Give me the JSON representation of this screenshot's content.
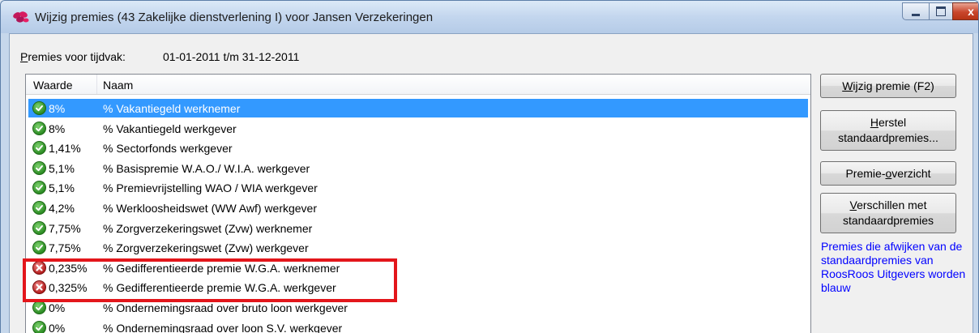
{
  "window": {
    "title": "Wijzig premies (43 Zakelijke dienstverlening I) voor Jansen Verzekeringen",
    "controls": {
      "minimize": "minimize",
      "maximize": "maximize",
      "close": "x"
    }
  },
  "period": {
    "label_accel": "P",
    "label_rest": "remies voor tijdvak:",
    "value": "01-01-2011 t/m 31-12-2011"
  },
  "table": {
    "columns": [
      "Waarde",
      "Naam"
    ],
    "rows": [
      {
        "status": "ok",
        "value": "8%",
        "name": "% Vakantiegeld werknemer",
        "selected": true
      },
      {
        "status": "ok",
        "value": "8%",
        "name": "% Vakantiegeld werkgever"
      },
      {
        "status": "ok",
        "value": "1,41%",
        "name": "% Sectorfonds werkgever"
      },
      {
        "status": "ok",
        "value": "5,1%",
        "name": "% Basispremie W.A.O./ W.I.A. werkgever"
      },
      {
        "status": "ok",
        "value": "5,1%",
        "name": "% Premievrijstelling WAO / WIA werkgever"
      },
      {
        "status": "ok",
        "value": "4,2%",
        "name": "% Werkloosheidswet (WW Awf) werkgever"
      },
      {
        "status": "ok",
        "value": "7,75%",
        "name": "% Zorgverzekeringswet (Zvw) werknemer"
      },
      {
        "status": "ok",
        "value": "7,75%",
        "name": "% Zorgverzekeringswet (Zvw) werkgever"
      },
      {
        "status": "error",
        "value": "0,235%",
        "name": "% Gedifferentieerde premie W.G.A. werknemer"
      },
      {
        "status": "error",
        "value": "0,325%",
        "name": "% Gedifferentieerde premie W.G.A. werkgever"
      },
      {
        "status": "ok",
        "value": "0%",
        "name": "% Ondernemingsraad over bruto loon werkgever"
      },
      {
        "status": "ok",
        "value": "0%",
        "name": "% Ondernemingsraad over loon S.V. werkgever"
      }
    ]
  },
  "buttons": {
    "wijzig": {
      "accel": "W",
      "rest": "ijzig premie (F2)"
    },
    "herstel": {
      "line1_accel": "H",
      "line1_rest": "erstel",
      "line2": "standaardpremies..."
    },
    "overzicht": {
      "before": "Premie-",
      "accel": "o",
      "after": "verzicht"
    },
    "verschillen": {
      "line1_accel": "V",
      "line1_rest": "erschillen met",
      "line2": "standaardpremies"
    }
  },
  "info_text": "Premies die afwijken van de standaardpremies van RoosRoos Uitgevers worden blauw",
  "colors": {
    "selection": "#3399ff",
    "highlight_box": "#e3161b",
    "info_text": "#0000ff",
    "ok_icon": "#2c8c24",
    "error_icon": "#b41e1e"
  }
}
